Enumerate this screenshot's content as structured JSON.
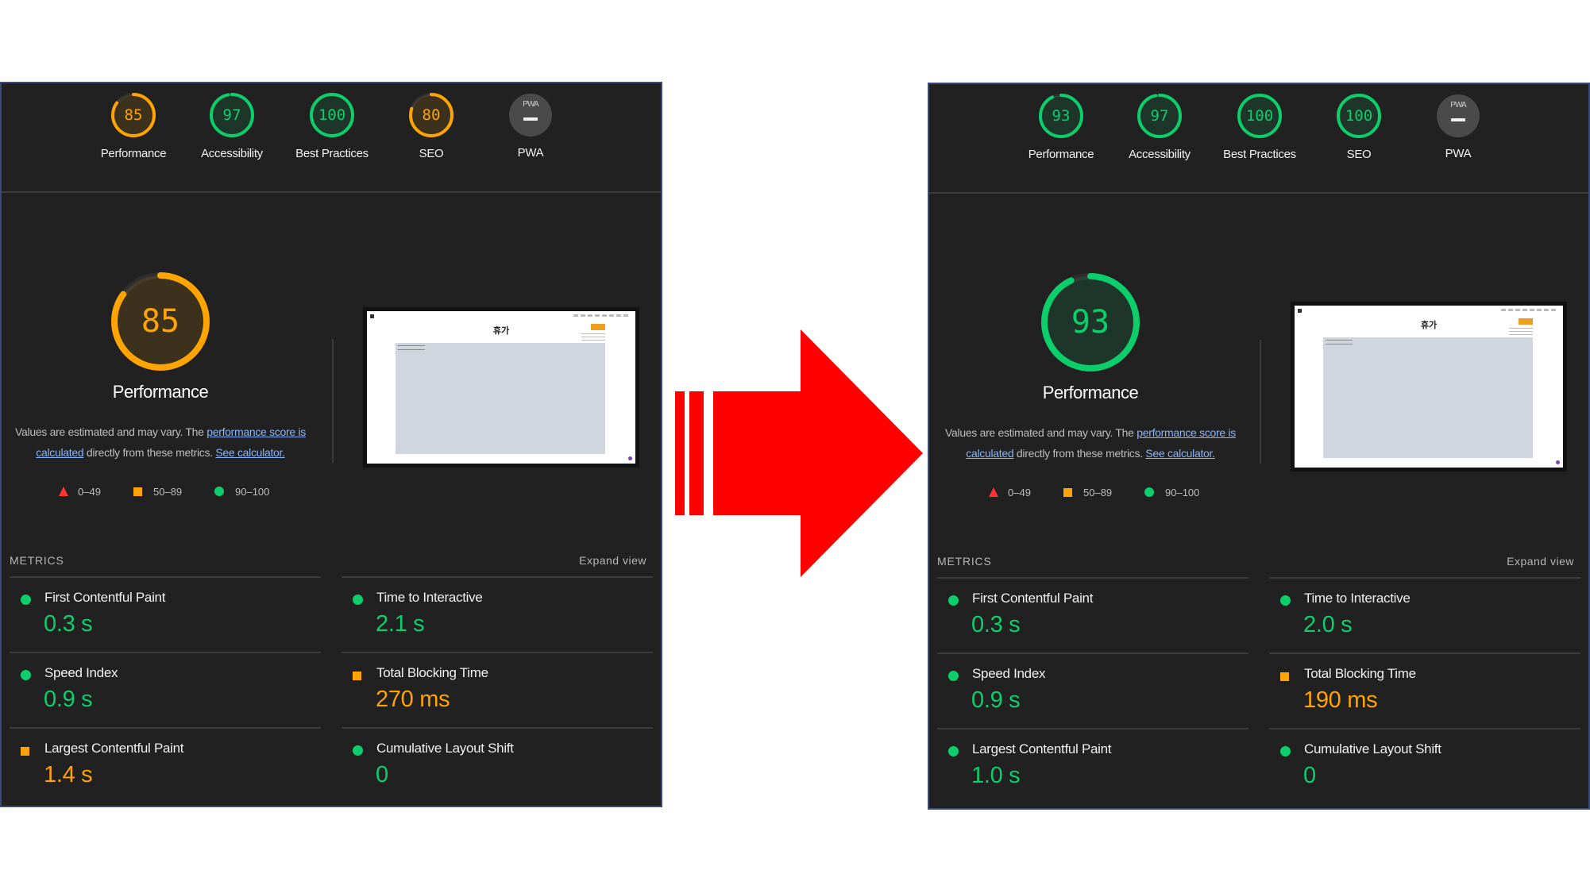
{
  "panels": [
    {
      "gauges": [
        {
          "score": "85",
          "label": "Performance",
          "status": "average"
        },
        {
          "score": "97",
          "label": "Accessibility",
          "status": "pass"
        },
        {
          "score": "100",
          "label": "Best Practices",
          "status": "pass"
        },
        {
          "score": "80",
          "label": "SEO",
          "status": "average"
        },
        {
          "pwa_text": "PWA",
          "label": "PWA"
        }
      ],
      "main_score": "85",
      "main_label": "Performance",
      "main_status": "average",
      "metrics": [
        {
          "name": "First Contentful Paint",
          "value": "0.3 s",
          "status": "pass"
        },
        {
          "name": "Time to Interactive",
          "value": "2.1 s",
          "status": "pass"
        },
        {
          "name": "Speed Index",
          "value": "0.9 s",
          "status": "pass"
        },
        {
          "name": "Total Blocking Time",
          "value": "270 ms",
          "status": "average"
        },
        {
          "name": "Largest Contentful Paint",
          "value": "1.4 s",
          "status": "average"
        },
        {
          "name": "Cumulative Layout Shift",
          "value": "0",
          "status": "pass"
        }
      ]
    },
    {
      "gauges": [
        {
          "score": "93",
          "label": "Performance",
          "status": "pass"
        },
        {
          "score": "97",
          "label": "Accessibility",
          "status": "pass"
        },
        {
          "score": "100",
          "label": "Best Practices",
          "status": "pass"
        },
        {
          "score": "100",
          "label": "SEO",
          "status": "pass"
        },
        {
          "pwa_text": "PWA",
          "label": "PWA"
        }
      ],
      "main_score": "93",
      "main_label": "Performance",
      "main_status": "pass",
      "metrics": [
        {
          "name": "First Contentful Paint",
          "value": "0.3 s",
          "status": "pass"
        },
        {
          "name": "Time to Interactive",
          "value": "2.0 s",
          "status": "pass"
        },
        {
          "name": "Speed Index",
          "value": "0.9 s",
          "status": "pass"
        },
        {
          "name": "Total Blocking Time",
          "value": "190 ms",
          "status": "average"
        },
        {
          "name": "Largest Contentful Paint",
          "value": "1.0 s",
          "status": "pass"
        },
        {
          "name": "Cumulative Layout Shift",
          "value": "0",
          "status": "pass"
        }
      ]
    }
  ],
  "description": {
    "part1": "Values are estimated and may vary. The ",
    "link1": "performance score is calculated",
    "part2": " directly from these metrics. ",
    "link2": "See calculator."
  },
  "legend": {
    "fail": "0–49",
    "average": "50–89",
    "pass": "90–100"
  },
  "metrics_header": "METRICS",
  "expand_label": "Expand view",
  "screenshot": {
    "title": "휴가"
  },
  "colors": {
    "pass": "#0cce6b",
    "average": "#ffa400",
    "fail": "#ff3333",
    "arrow": "#ff0000",
    "panel_bg": "#212121"
  }
}
